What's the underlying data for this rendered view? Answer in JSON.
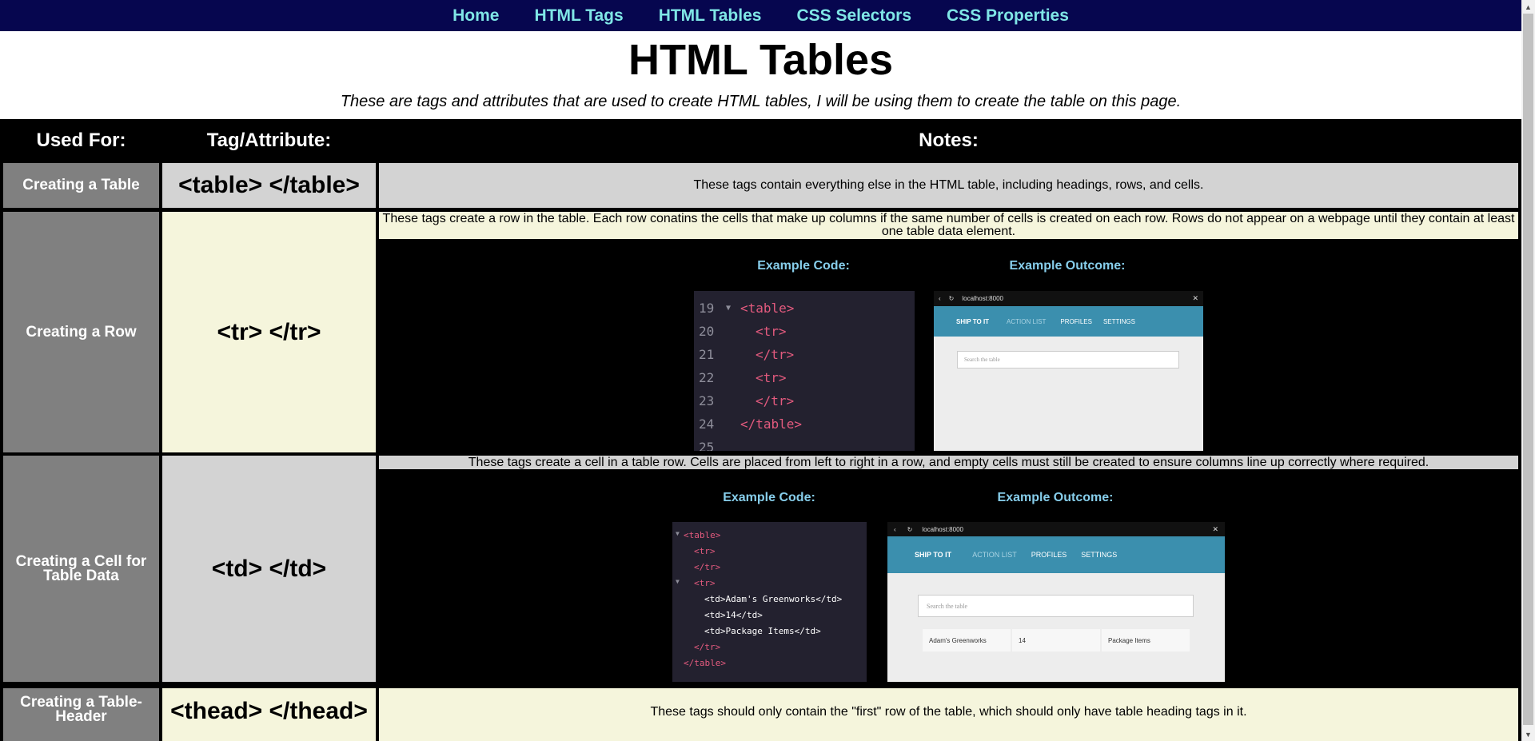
{
  "nav": {
    "items": [
      "Home",
      "HTML Tags",
      "HTML Tables",
      "CSS Selectors",
      "CSS Properties"
    ]
  },
  "page": {
    "title": "HTML Tables",
    "subtitle": "These are tags and attributes that are used to create HTML tables, I will be using them to create the table on this page."
  },
  "table": {
    "headers": [
      "Used For:",
      "Tag/Attribute:",
      "Notes:"
    ],
    "rows": [
      {
        "used_for": "Creating a Table",
        "tag": "<table> </table>",
        "note": "These tags contain everything else in the HTML table, including headings, rows, and cells."
      },
      {
        "used_for": "Creating a Row",
        "tag": "<tr> </tr>",
        "note": "These tags create a row in the table. Each row conatins the cells that make up columns if the same number of cells is created on each row. Rows do not appear on a webpage until they contain at least one table data element.",
        "example_code_label": "Example Code:",
        "example_outcome_label": "Example Outcome:"
      },
      {
        "used_for": "Creating a Cell for Table Data",
        "tag": "<td> </td>",
        "note": "These tags create a cell in a table row. Cells are placed from left to right in a row, and empty cells must still be created to ensure columns line up correctly where required.",
        "example_code_label": "Example Code:",
        "example_outcome_label": "Example Outcome:"
      },
      {
        "used_for": "Creating a Table-Header",
        "tag": "<thead> </thead>",
        "note": "These tags should only contain the \"first\" row of the table, which should only have table heading tags in it."
      }
    ]
  },
  "code_example_1": {
    "line_numbers": [
      "19",
      "20",
      "21",
      "22",
      "23",
      "24",
      "25"
    ],
    "lines": [
      "<table>",
      "<tr>",
      "</tr>",
      "<tr>",
      "</tr>",
      "</table>",
      ""
    ]
  },
  "outcome_1": {
    "url": "localhost:8000",
    "brand": "SHIP TO IT",
    "menu": [
      "ACTION LIST",
      "PROFILES",
      "SETTINGS"
    ],
    "search_placeholder": "Search the table"
  },
  "code_example_2": {
    "lines": [
      "<table>",
      "<tr>",
      "</tr>",
      "<tr>",
      "<td>Adam's Greenworks</td>",
      "<td>14</td>",
      "<td>Package Items</td>",
      "</tr>",
      "</table>"
    ]
  },
  "outcome_2": {
    "url": "localhost:8000",
    "brand": "SHIP TO IT",
    "menu": [
      "ACTION LIST",
      "PROFILES",
      "SETTINGS"
    ],
    "search_placeholder": "Search the table",
    "cells": [
      "Adam's Greenworks",
      "14",
      "Package Items"
    ]
  },
  "colors": {
    "nav_bg": "#06064f",
    "nav_link": "#7fe6e6",
    "col1_bg": "#808080",
    "grey_bg": "#d3d3d3",
    "cream_bg": "#f5f5dc",
    "example_label": "#87ceeb"
  }
}
